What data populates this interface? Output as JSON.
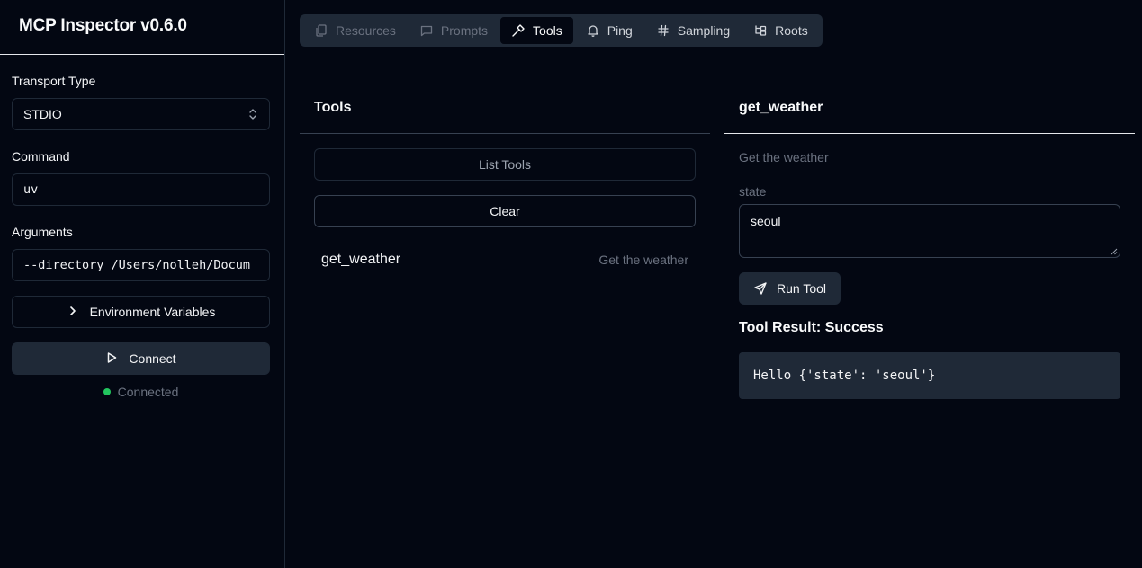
{
  "app": {
    "title": "MCP Inspector v0.6.0"
  },
  "sidebar": {
    "transport_label": "Transport Type",
    "transport_value": "STDIO",
    "command_label": "Command",
    "command_value": "uv",
    "arguments_label": "Arguments",
    "arguments_value": "--directory /Users/nolleh/Docum",
    "env_button": "Environment Variables",
    "connect_button": "Connect",
    "status_text": "Connected",
    "status_color": "#22c55e"
  },
  "tabs": [
    {
      "label": "Resources",
      "icon": "files-icon",
      "state": "disabled"
    },
    {
      "label": "Prompts",
      "icon": "message-square-icon",
      "state": "disabled"
    },
    {
      "label": "Tools",
      "icon": "hammer-icon",
      "state": "active"
    },
    {
      "label": "Ping",
      "icon": "bell-icon",
      "state": "enabled"
    },
    {
      "label": "Sampling",
      "icon": "hash-icon",
      "state": "enabled"
    },
    {
      "label": "Roots",
      "icon": "folder-tree-icon",
      "state": "enabled"
    }
  ],
  "tools_panel": {
    "title": "Tools",
    "list_button": "List Tools",
    "clear_button": "Clear",
    "items": [
      {
        "name": "get_weather",
        "description": "Get the weather"
      }
    ]
  },
  "detail_panel": {
    "title": "get_weather",
    "description": "Get the weather",
    "param_label": "state",
    "param_value": "seoul",
    "run_button": "Run Tool",
    "result_title": "Tool Result: Success",
    "result_text": "Hello {'state': 'seoul'}"
  }
}
